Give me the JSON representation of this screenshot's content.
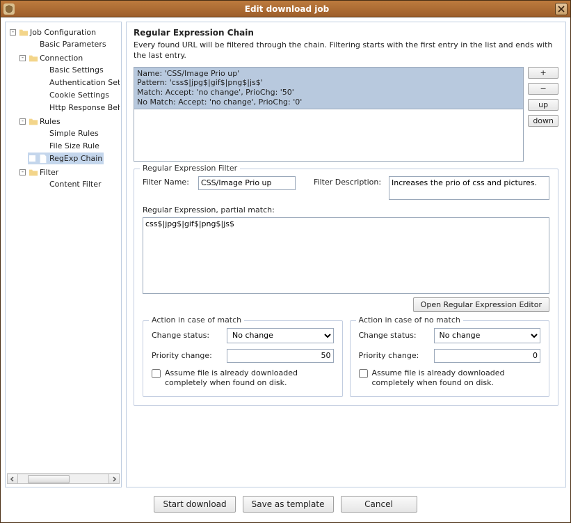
{
  "window": {
    "title": "Edit download job"
  },
  "tree": {
    "root": "Job Configuration",
    "basic": "Basic Parameters",
    "connection": "Connection",
    "conn_basic": "Basic Settings",
    "conn_auth": "Authentication Settings",
    "conn_cookie": "Cookie Settings",
    "conn_http": "Http Response Behaviour",
    "rules": "Rules",
    "rules_simple": "Simple Rules",
    "rules_filesize": "File Size Rule",
    "rules_regexp": "RegExp Chain",
    "filter": "Filter",
    "filter_content": "Content Filter"
  },
  "chain": {
    "title": "Regular Expression Chain",
    "desc": "Every found URL will be filtered through the chain. Filtering starts with the first entry in the list and ends with the last entry.",
    "item": {
      "l1": "Name: 'CSS/Image Prio up'",
      "l2": "Pattern: 'css$|jpg$|gif$|png$|js$'",
      "l3": "Match: Accept: 'no change', PrioChg: '50'",
      "l4": "No Match: Accept: 'no change', PrioChg: '0'"
    },
    "btns": {
      "plus": "+",
      "minus": "−",
      "up": "up",
      "down": "down"
    }
  },
  "filterbox": {
    "legend": "Regular Expression Filter",
    "name_label": "Filter Name:",
    "name_value": "CSS/Image Prio up",
    "desc_label": "Filter Description:",
    "desc_value": "Increases the prio of css and pictures.",
    "regex_label": "Regular Expression, partial match:",
    "regex_value": "css$|jpg$|gif$|png$|js$",
    "open_editor": "Open Regular Expression Editor"
  },
  "match": {
    "legend": "Action in case of match",
    "status_label": "Change status:",
    "status_value": "No change",
    "prio_label": "Priority change:",
    "prio_value": "50",
    "assume": "Assume file is already downloaded completely when found on disk."
  },
  "nomatch": {
    "legend": "Action in case of no match",
    "status_label": "Change status:",
    "status_value": "No change",
    "prio_label": "Priority change:",
    "prio_value": "0",
    "assume": "Assume file is already downloaded completely when found on disk."
  },
  "footer": {
    "start": "Start download",
    "save": "Save as template",
    "cancel": "Cancel"
  }
}
